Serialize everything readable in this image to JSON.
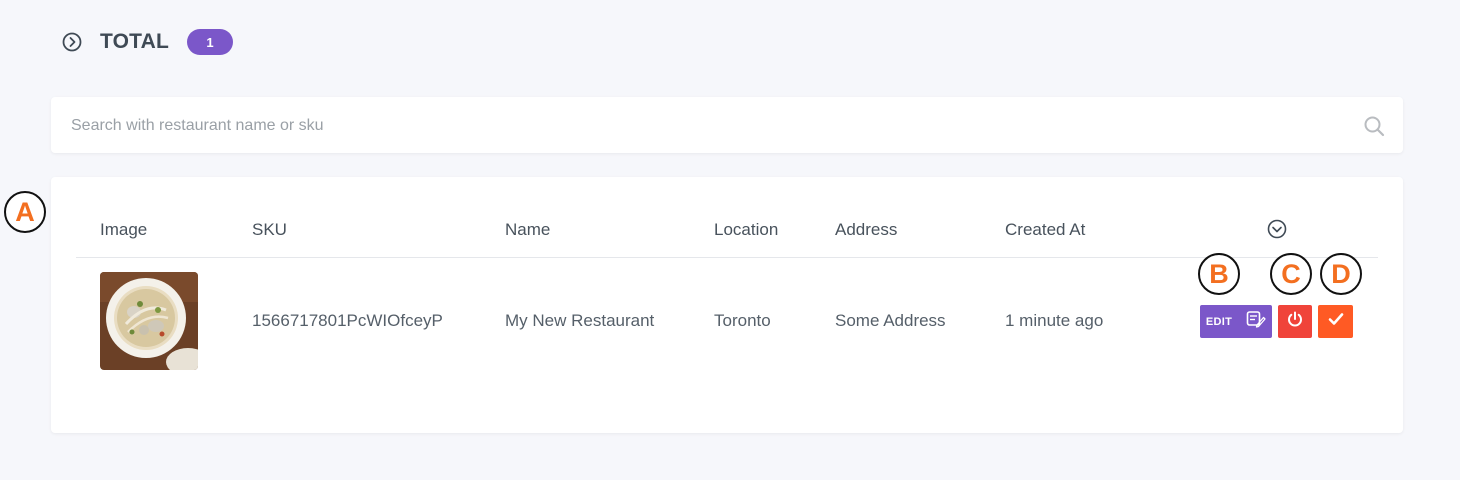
{
  "header": {
    "title": "TOTAL",
    "count": "1"
  },
  "search": {
    "placeholder": "Search with restaurant name or sku",
    "value": ""
  },
  "table": {
    "columns": [
      "Image",
      "SKU",
      "Name",
      "Location",
      "Address",
      "Created At"
    ],
    "rows": [
      {
        "image": "food-bowl-thumbnail",
        "sku": "1566717801PcWIOfceyP",
        "name": "My New Restaurant",
        "location": "Toronto",
        "address": "Some Address",
        "created_at": "1 minute ago",
        "edit_label": "EDIT"
      }
    ]
  },
  "markers": [
    "A",
    "B",
    "C",
    "D"
  ],
  "colors": {
    "accent_purple": "#7b57c9",
    "power_red": "#f0443a",
    "approve_orange": "#ff5a24",
    "marker_orange": "#f36f20",
    "background": "#f6f7fb"
  },
  "icons": [
    "chevron-right-circle-icon",
    "search-icon",
    "chevron-down-circle-icon",
    "edit-note-icon",
    "power-icon",
    "check-icon"
  ]
}
